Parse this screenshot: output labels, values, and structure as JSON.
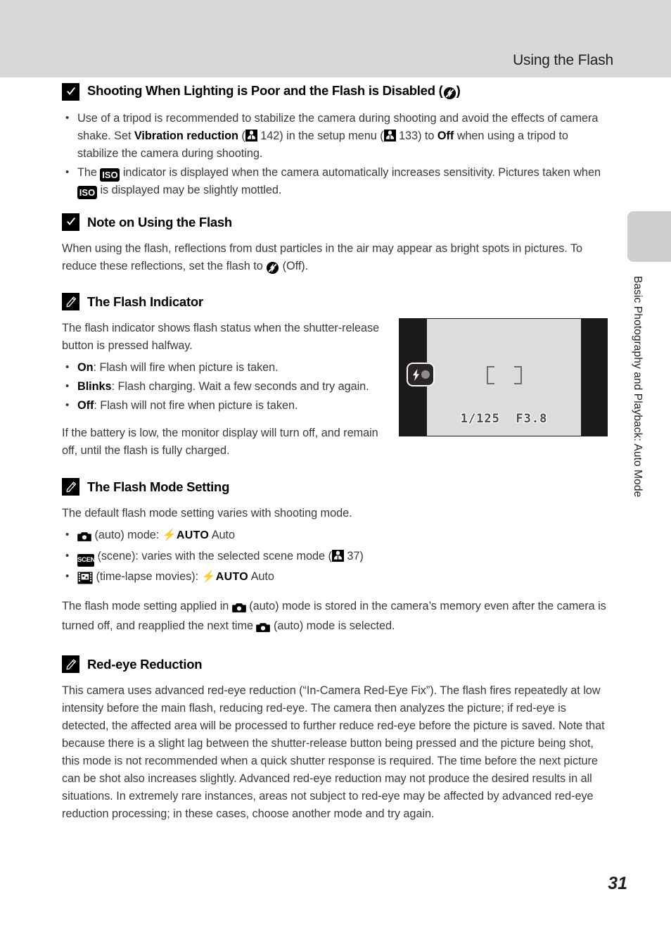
{
  "header": {
    "title": "Using the Flash"
  },
  "sidebar": {
    "chapter_label": "Basic Photography and Playback: Auto Mode"
  },
  "page_number": "31",
  "sections": [
    {
      "id": "shooting-when-lighting-poor",
      "icon": "warning-check-icon",
      "title": "Shooting When Lighting is Poor and the Flash is Disabled (",
      "title_suffix": ")",
      "bullets": [
        {
          "part1": "Use of a tripod is recommended to stabilize the camera during shooting and avoid the effects of camera shake. Set ",
          "bold1": "Vibration reduction",
          "part2": " (",
          "ref1": "142",
          "part3": ") in the setup menu (",
          "ref2": "133",
          "part4": ") to ",
          "bold2": "Off",
          "part5": " when using a tripod to stabilize the camera during shooting."
        },
        {
          "part1": "The ",
          "iso": "ISO",
          "part2": " indicator is displayed when the camera automatically increases sensitivity. Pictures taken when ",
          "iso2": "ISO",
          "part3": " is displayed may be slightly mottled."
        }
      ]
    },
    {
      "id": "note-on-using-the-flash",
      "icon": "warning-check-icon",
      "title": "Note on Using the Flash",
      "body_part1": "When using the flash, reflections from dust particles in the air may appear as bright spots in pictures. To reduce these reflections, set the flash to ",
      "body_part2": " (Off)."
    },
    {
      "id": "the-flash-indicator",
      "icon": "pencil-note-icon",
      "title": "The Flash Indicator",
      "intro": "The flash indicator shows flash status when the shutter-release button is pressed halfway.",
      "bullets": [
        {
          "bold": "On",
          "text": ": Flash will fire when picture is taken."
        },
        {
          "bold": "Blinks",
          "text": ": Flash charging. Wait a few seconds and try again."
        },
        {
          "bold": "Off",
          "text": ": Flash will not fire when picture is taken."
        }
      ],
      "outro": "If the battery is low, the monitor display will turn off, and remain off, until the flash is fully charged."
    },
    {
      "id": "the-flash-mode-setting",
      "icon": "pencil-note-icon",
      "title": "The Flash Mode Setting",
      "intro": "The default flash mode setting varies with shooting mode.",
      "bullets": [
        {
          "mode_icon": "camera-auto-icon",
          "text1": " (auto) mode: ",
          "flash_auto": "AUTO",
          "text2": " Auto"
        },
        {
          "mode_icon": "scene-icon",
          "text1": " (scene): varies with the selected scene mode (",
          "ref": "37",
          "text2": ")"
        },
        {
          "mode_icon": "time-lapse-movie-icon",
          "text1": " (time-lapse movies): ",
          "flash_auto": "AUTO",
          "text2": " Auto"
        }
      ],
      "outro_part1": "The flash mode setting applied in ",
      "outro_part2": " (auto) mode is stored in the camera’s memory even after the camera is turned off, and reapplied the next time ",
      "outro_part3": " (auto) mode is selected."
    },
    {
      "id": "red-eye-reduction",
      "icon": "pencil-note-icon",
      "title": "Red-eye Reduction",
      "body": "This camera uses advanced red-eye reduction (“In-Camera Red-Eye Fix”). The flash fires repeatedly at low intensity before the main flash, reducing red-eye. The camera then analyzes the picture; if red-eye is detected, the affected area will be processed to further reduce red-eye before the picture is saved. Note that because there is a slight lag between the shutter-release button being pressed and the picture being shot, this mode is not recommended when a quick shutter response is required. The time before the next picture can be shot also increases slightly. Advanced red-eye reduction may not produce the desired results in all situations. In extremely rare instances, areas not subject to red-eye may be affected by advanced red-eye reduction processing; in these cases, choose another mode and try again."
    }
  ],
  "monitor_figure": {
    "shutter_speed": "1/125",
    "aperture": "F3.8",
    "flash_indicator_icon": "flash-ready-indicator-icon"
  },
  "colors": {
    "header_band": "#d8d8d8",
    "side_tab": "#cfcfcf",
    "monitor_frame": "#1b1b1b",
    "monitor_screen": "#dcdcdc",
    "text": "#3a3a3a"
  }
}
